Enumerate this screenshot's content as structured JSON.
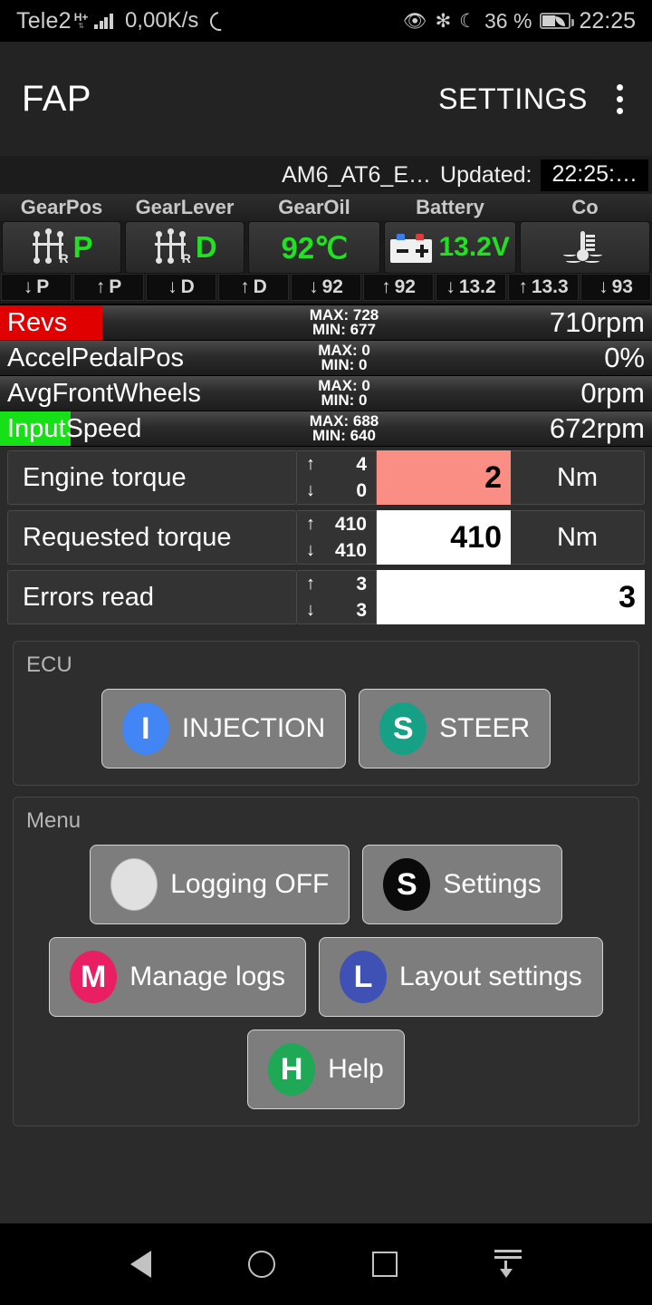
{
  "status_bar": {
    "carrier": "Tele2",
    "network_type": "H+",
    "data_speed": "0,00K/s",
    "sync_icon": "sync-icon",
    "eye_comfort_icon": "eye-comfort-icon",
    "bluetooth_icon": "bluetooth-icon",
    "dnd_icon": "do-not-disturb-moon-icon",
    "battery_percent": "36 %",
    "battery_icon": "battery-saver-icon",
    "time": "22:25"
  },
  "app_bar": {
    "title": "FAP",
    "settings_label": "SETTINGS",
    "overflow_icon": "overflow-menu-icon"
  },
  "info_line": {
    "profile": "AM6_AT6_E…",
    "updated_label": "Updated:",
    "updated_time": "22:25:…"
  },
  "gauges": [
    {
      "label": "GearPos",
      "icon": "gear-shifter-icon",
      "value": "P",
      "min": "P",
      "max": "P",
      "value_color": "#22e022"
    },
    {
      "label": "GearLever",
      "icon": "gear-shifter-icon",
      "value": "D",
      "min": "D",
      "max": "D",
      "value_color": "#22e022"
    },
    {
      "label": "GearOil",
      "icon": "",
      "value": "92℃",
      "min": "92",
      "max": "92",
      "value_color": "#22e022"
    },
    {
      "label": "Battery",
      "icon": "car-battery-icon",
      "value": "13.2V",
      "min": "13.2",
      "max": "13.3",
      "value_color": "#22e022"
    },
    {
      "label": "Co",
      "icon": "coolant-temperature-icon",
      "value": "",
      "min": "93",
      "max": "",
      "value_color": "#22e022"
    }
  ],
  "bar_rows": [
    {
      "name": "Revs",
      "max_label": "MAX: 728",
      "min_label": "MIN: 677",
      "value": "710rpm",
      "fill_color": "#e00000",
      "fill_percent": 15.7
    },
    {
      "name": "AccelPedalPos",
      "max_label": "MAX: 0",
      "min_label": "MIN: 0",
      "value": "0%",
      "fill_color": "#e00000",
      "fill_percent": 0
    },
    {
      "name": "AvgFrontWheels",
      "max_label": "MAX: 0",
      "min_label": "MIN: 0",
      "value": "0rpm",
      "fill_color": "#e00000",
      "fill_percent": 0
    },
    {
      "name": "InputSpeed",
      "max_label": "MAX: 688",
      "min_label": "MIN: 640",
      "value": "672rpm",
      "fill_color": "#16e016",
      "fill_percent": 10.9
    }
  ],
  "value_rows": [
    {
      "label": "Engine torque",
      "up": "4",
      "down": "0",
      "value": "2",
      "unit": "Nm",
      "value_bg": "#fa8d84",
      "has_unit": true
    },
    {
      "label": "Requested torque",
      "up": "410",
      "down": "410",
      "value": "410",
      "unit": "Nm",
      "value_bg": "#ffffff",
      "has_unit": true
    },
    {
      "label": "Errors read",
      "up": "3",
      "down": "3",
      "value": "3",
      "unit": "",
      "value_bg": "#ffffff",
      "has_unit": false
    }
  ],
  "ecu_card": {
    "title": "ECU",
    "buttons": [
      {
        "label": "INJECTION",
        "badge": "I",
        "badge_color": "#4285f4",
        "icon": "injection-ecu-icon"
      },
      {
        "label": "STEER",
        "badge": "S",
        "badge_color": "#16a085",
        "icon": "steer-ecu-icon"
      }
    ]
  },
  "menu_card": {
    "title": "Menu",
    "buttons": [
      {
        "label": "Logging OFF",
        "badge": "",
        "badge_color": "#e0e0e0",
        "icon": "logging-toggle-icon"
      },
      {
        "label": "Settings",
        "badge": "S",
        "badge_color": "#0a0a0a",
        "icon": "settings-icon"
      },
      {
        "label": "Manage logs",
        "badge": "M",
        "badge_color": "#e91e63",
        "icon": "manage-logs-icon"
      },
      {
        "label": "Layout settings",
        "badge": "L",
        "badge_color": "#3f51b5",
        "icon": "layout-settings-icon"
      },
      {
        "label": "Help",
        "badge": "H",
        "badge_color": "#1fa855",
        "icon": "help-icon"
      }
    ]
  },
  "nav_bar": {
    "back": "back-icon",
    "home": "home-icon",
    "recents": "recents-icon",
    "hide": "hide-navbar-icon"
  }
}
